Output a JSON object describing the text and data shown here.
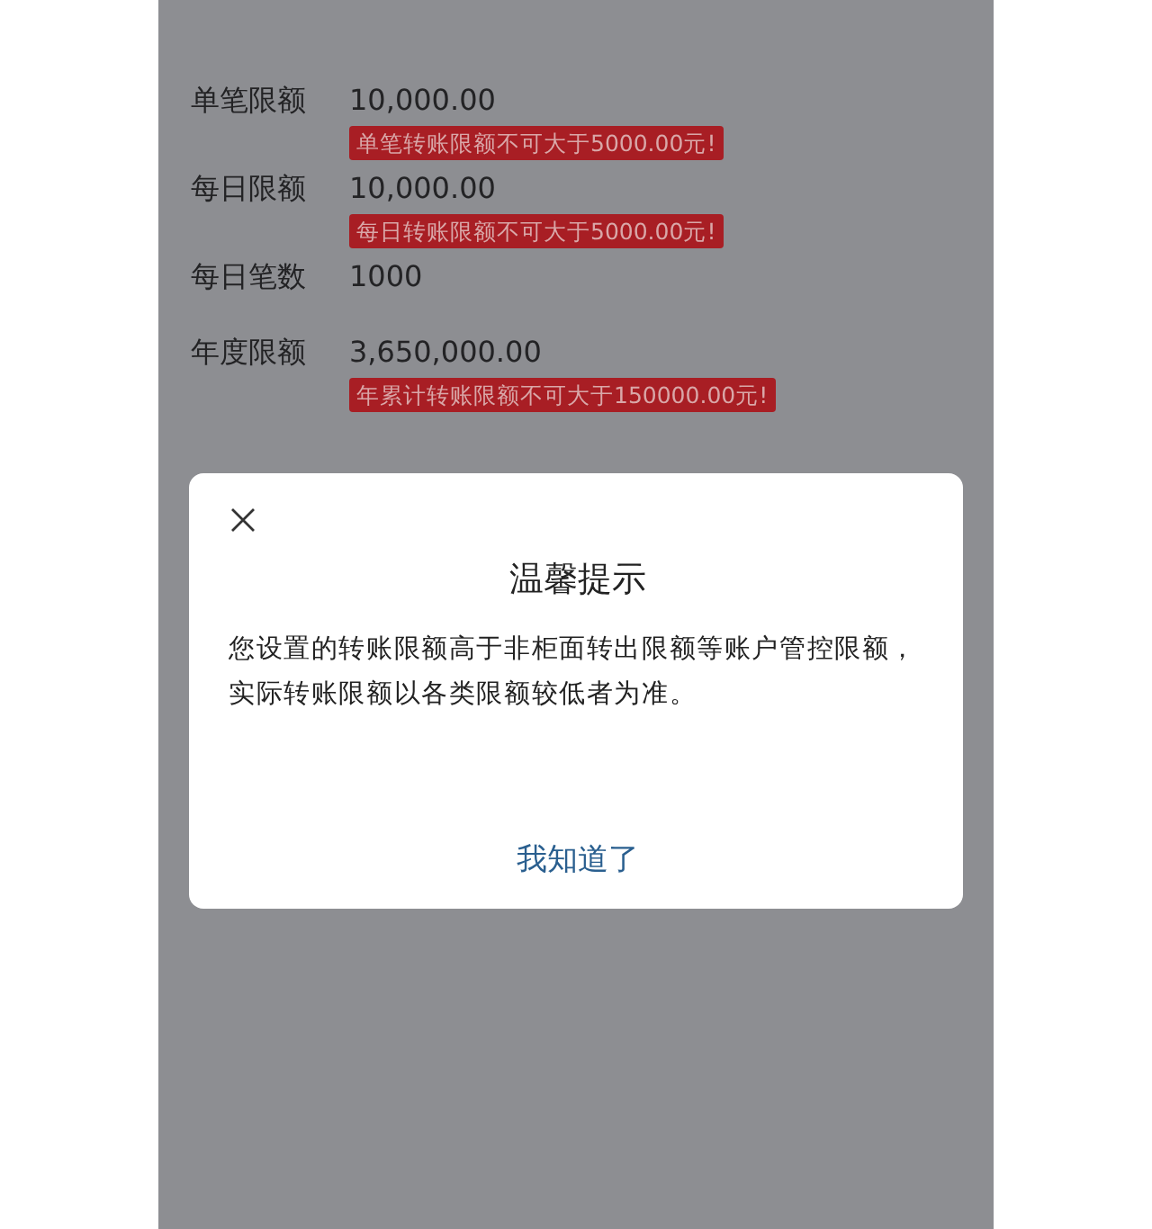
{
  "limits": [
    {
      "label": "单笔限额",
      "value": "10,000.00",
      "error": "单笔转账限额不可大于5000.00元!"
    },
    {
      "label": "每日限额",
      "value": "10,000.00",
      "error": "每日转账限额不可大于5000.00元!"
    },
    {
      "label": "每日笔数",
      "value": "1000"
    },
    {
      "label": "年度限额",
      "value": "3,650,000.00",
      "error": "年累计转账限额不可大于150000.00元!"
    }
  ],
  "dialog": {
    "title": "温馨提示",
    "message": "您设置的转账限额高于非柜面转出限额等账户管控限额，实际转账限额以各类限额较低者为准。",
    "button": "我知道了"
  }
}
